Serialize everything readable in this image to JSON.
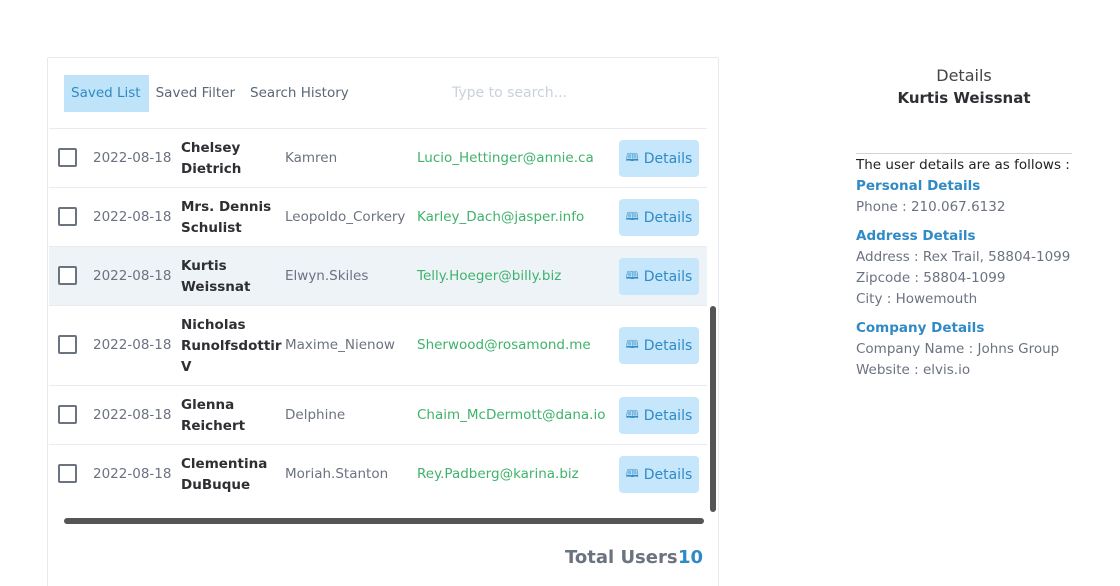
{
  "tabs": [
    {
      "label": "Saved List",
      "active": true
    },
    {
      "label": "Saved Filter",
      "active": false
    },
    {
      "label": "Search History",
      "active": false
    }
  ],
  "search": {
    "placeholder": "Type to search..."
  },
  "rows": [
    {
      "date": "2022-08-18",
      "name": "Chelsey Dietrich",
      "username": "Kamren",
      "email": "Lucio_Hettinger@annie.ca",
      "button": "Details"
    },
    {
      "date": "2022-08-18",
      "name": "Mrs. Dennis Schulist",
      "username": "Leopoldo_Corkery",
      "email": "Karley_Dach@jasper.info",
      "button": "Details"
    },
    {
      "date": "2022-08-18",
      "name": "Kurtis Weissnat",
      "username": "Elwyn.Skiles",
      "email": "Telly.Hoeger@billy.biz",
      "button": "Details",
      "highlighted": true
    },
    {
      "date": "2022-08-18",
      "name": "Nicholas Runolfsdottir V",
      "username": "Maxime_Nienow",
      "email": "Sherwood@rosamond.me",
      "button": "Details"
    },
    {
      "date": "2022-08-18",
      "name": "Glenna Reichert",
      "username": "Delphine",
      "email": "Chaim_McDermott@dana.io",
      "button": "Details"
    },
    {
      "date": "2022-08-18",
      "name": "Clementina DuBuque",
      "username": "Moriah.Stanton",
      "email": "Rey.Padberg@karina.biz",
      "button": "Details"
    }
  ],
  "details_icon": "map-icon",
  "total": {
    "label": "Total Users",
    "value": "10"
  },
  "detail": {
    "heading": "Details",
    "name": "Kurtis Weissnat",
    "intro": "The user details are as follows :",
    "personal": {
      "title": "Personal Details",
      "phone": "Phone : 210.067.6132"
    },
    "address": {
      "title": "Address Details",
      "address": "Address : Rex Trail, 58804-1099",
      "zipcode": "Zipcode : 58804-1099",
      "city": "City : Howemouth"
    },
    "company": {
      "title": "Company Details",
      "name": "Company Name : Johns Group",
      "website": "Website : elvis.io"
    }
  },
  "colors": {
    "accent": "#2f8ac5",
    "email": "#3fb36b",
    "button_bg": "#c6e6fb",
    "active_tab_bg": "#bfe3f8"
  }
}
